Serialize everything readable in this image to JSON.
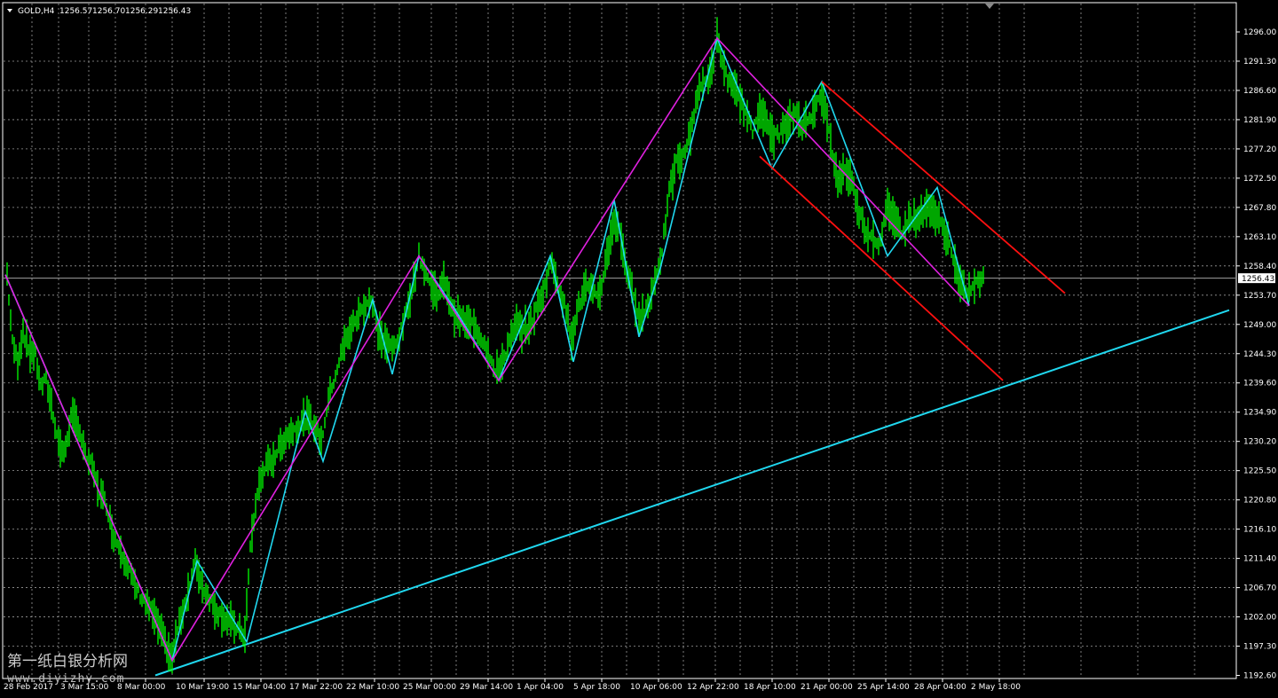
{
  "header": {
    "symbol": "GOLD,H4",
    "open": "1256.57",
    "high": "1256.70",
    "low": "1256.29",
    "close": "1256.43"
  },
  "watermark": {
    "line1": "第一纸白银分析网",
    "line2": "www.diyizhy.com"
  },
  "colors": {
    "background": "#000000",
    "grid": "#9a9a9a",
    "axis": "#ffffff",
    "price": "#00ff00",
    "zigzag_major": "#e020e0",
    "zigzag_minor": "#20d8f0",
    "channel": "#ff1010",
    "trendline": "#20d8f0",
    "current_price_line": "#a0a0a0"
  },
  "chart_data": {
    "type": "line",
    "grid": true,
    "ylim": [
      1192.6,
      1298.2
    ],
    "xlim": [
      0,
      1400
    ],
    "y_ticks": [
      "1296.00",
      "1291.30",
      "1286.60",
      "1281.90",
      "1277.20",
      "1272.50",
      "1267.80",
      "1263.10",
      "1258.40",
      "1253.70",
      "1249.00",
      "1244.30",
      "1239.60",
      "1234.90",
      "1230.20",
      "1225.50",
      "1220.80",
      "1216.10",
      "1211.40",
      "1206.70",
      "1202.00",
      "1197.30",
      "1192.60"
    ],
    "x_ticks": [
      {
        "label": "28 Feb 2017",
        "x": 2
      },
      {
        "label": "3 Mar 15:00",
        "x": 66
      },
      {
        "label": "8 Mar 00:00",
        "x": 130
      },
      {
        "label": "10 Mar 19:00",
        "x": 196
      },
      {
        "label": "15 Mar 04:00",
        "x": 260
      },
      {
        "label": "17 Mar 22:00",
        "x": 324
      },
      {
        "label": "22 Mar 10:00",
        "x": 388
      },
      {
        "label": "25 Mar 00:00",
        "x": 452
      },
      {
        "label": "29 Mar 14:00",
        "x": 516
      },
      {
        "label": "1 Apr 04:00",
        "x": 580
      },
      {
        "label": "5 Apr 18:00",
        "x": 644
      },
      {
        "label": "10 Apr 06:00",
        "x": 708
      },
      {
        "label": "12 Apr 22:00",
        "x": 772
      },
      {
        "label": "18 Apr 10:00",
        "x": 836
      },
      {
        "label": "21 Apr 00:00",
        "x": 900
      },
      {
        "label": "25 Apr 14:00",
        "x": 964
      },
      {
        "label": "28 Apr 04:00",
        "x": 1028
      },
      {
        "label": "2 May 18:00",
        "x": 1092
      }
    ],
    "current_price": 1256.43,
    "price_anchors": [
      [
        8,
        1257
      ],
      [
        14,
        1246
      ],
      [
        20,
        1243
      ],
      [
        26,
        1248
      ],
      [
        32,
        1245
      ],
      [
        40,
        1244
      ],
      [
        46,
        1239
      ],
      [
        52,
        1240
      ],
      [
        58,
        1236
      ],
      [
        66,
        1230
      ],
      [
        72,
        1228
      ],
      [
        80,
        1234
      ],
      [
        88,
        1233
      ],
      [
        96,
        1228
      ],
      [
        104,
        1226
      ],
      [
        112,
        1222
      ],
      [
        120,
        1220
      ],
      [
        128,
        1215
      ],
      [
        136,
        1213
      ],
      [
        144,
        1210
      ],
      [
        152,
        1207
      ],
      [
        160,
        1205
      ],
      [
        170,
        1203
      ],
      [
        180,
        1200
      ],
      [
        188,
        1197
      ],
      [
        194,
        1195
      ],
      [
        200,
        1200
      ],
      [
        206,
        1203
      ],
      [
        212,
        1206
      ],
      [
        220,
        1211
      ],
      [
        228,
        1207
      ],
      [
        236,
        1205
      ],
      [
        244,
        1203
      ],
      [
        252,
        1202
      ],
      [
        260,
        1201
      ],
      [
        268,
        1200
      ],
      [
        276,
        1199
      ],
      [
        282,
        1213
      ],
      [
        290,
        1222
      ],
      [
        298,
        1226
      ],
      [
        306,
        1227
      ],
      [
        314,
        1229
      ],
      [
        322,
        1231
      ],
      [
        330,
        1232
      ],
      [
        338,
        1233
      ],
      [
        346,
        1234
      ],
      [
        354,
        1233
      ],
      [
        362,
        1230
      ],
      [
        370,
        1237
      ],
      [
        378,
        1241
      ],
      [
        386,
        1245
      ],
      [
        394,
        1248
      ],
      [
        402,
        1250
      ],
      [
        410,
        1252
      ],
      [
        418,
        1253
      ],
      [
        426,
        1248
      ],
      [
        434,
        1246
      ],
      [
        442,
        1245
      ],
      [
        450,
        1247
      ],
      [
        458,
        1251
      ],
      [
        466,
        1256
      ],
      [
        472,
        1260
      ],
      [
        478,
        1258
      ],
      [
        486,
        1255
      ],
      [
        494,
        1254
      ],
      [
        502,
        1256
      ],
      [
        510,
        1251
      ],
      [
        518,
        1250
      ],
      [
        526,
        1249
      ],
      [
        534,
        1249
      ],
      [
        542,
        1247
      ],
      [
        550,
        1245
      ],
      [
        558,
        1241
      ],
      [
        566,
        1243
      ],
      [
        574,
        1246
      ],
      [
        582,
        1249
      ],
      [
        590,
        1248
      ],
      [
        598,
        1249
      ],
      [
        606,
        1252
      ],
      [
        614,
        1255
      ],
      [
        620,
        1259
      ],
      [
        628,
        1256
      ],
      [
        636,
        1252
      ],
      [
        644,
        1247
      ],
      [
        652,
        1252
      ],
      [
        660,
        1255
      ],
      [
        668,
        1254
      ],
      [
        676,
        1254
      ],
      [
        684,
        1260
      ],
      [
        692,
        1266
      ],
      [
        698,
        1264
      ],
      [
        706,
        1258
      ],
      [
        714,
        1253
      ],
      [
        722,
        1250
      ],
      [
        730,
        1252
      ],
      [
        738,
        1256
      ],
      [
        746,
        1261
      ],
      [
        754,
        1270
      ],
      [
        762,
        1275
      ],
      [
        770,
        1276
      ],
      [
        778,
        1280
      ],
      [
        786,
        1286
      ],
      [
        794,
        1288
      ],
      [
        802,
        1290
      ],
      [
        808,
        1295
      ],
      [
        816,
        1290
      ],
      [
        824,
        1287
      ],
      [
        832,
        1286
      ],
      [
        840,
        1283
      ],
      [
        848,
        1280
      ],
      [
        856,
        1284
      ],
      [
        864,
        1281
      ],
      [
        872,
        1279
      ],
      [
        880,
        1280
      ],
      [
        888,
        1281
      ],
      [
        896,
        1283
      ],
      [
        904,
        1281
      ],
      [
        912,
        1282
      ],
      [
        920,
        1285
      ],
      [
        928,
        1285
      ],
      [
        936,
        1278
      ],
      [
        944,
        1272
      ],
      [
        952,
        1274
      ],
      [
        960,
        1272
      ],
      [
        968,
        1267
      ],
      [
        976,
        1264
      ],
      [
        984,
        1263
      ],
      [
        992,
        1262
      ],
      [
        1000,
        1268
      ],
      [
        1008,
        1266
      ],
      [
        1016,
        1264
      ],
      [
        1024,
        1266
      ],
      [
        1032,
        1266
      ],
      [
        1040,
        1267
      ],
      [
        1048,
        1268
      ],
      [
        1056,
        1266
      ],
      [
        1064,
        1264
      ],
      [
        1072,
        1261
      ],
      [
        1080,
        1256
      ],
      [
        1088,
        1254
      ],
      [
        1096,
        1255
      ],
      [
        1104,
        1256
      ],
      [
        1110,
        1256.4
      ]
    ],
    "zigzag_major": [
      [
        6,
        1257
      ],
      [
        194,
        1195
      ],
      [
        472,
        1260
      ],
      [
        562,
        1240
      ],
      [
        808,
        1295
      ],
      [
        1092,
        1252
      ]
    ],
    "zigzag_minor": [
      [
        6,
        1257
      ],
      [
        194,
        1195
      ],
      [
        222,
        1211
      ],
      [
        278,
        1198
      ],
      [
        344,
        1235
      ],
      [
        364,
        1227
      ],
      [
        420,
        1253
      ],
      [
        442,
        1241
      ],
      [
        472,
        1260
      ],
      [
        510,
        1252
      ],
      [
        562,
        1240
      ],
      [
        620,
        1260
      ],
      [
        646,
        1243
      ],
      [
        692,
        1269
      ],
      [
        720,
        1247
      ],
      [
        744,
        1258
      ],
      [
        808,
        1295
      ],
      [
        870,
        1274
      ],
      [
        926,
        1288
      ],
      [
        1000,
        1260
      ],
      [
        1056,
        1271
      ],
      [
        1092,
        1252
      ]
    ],
    "channel_upper": [
      [
        926,
        1288
      ],
      [
        1200,
        1254
      ]
    ],
    "channel_lower": [
      [
        856,
        1276
      ],
      [
        1130,
        1240
      ]
    ],
    "trendline": [
      [
        175,
        1192.6
      ],
      [
        1385,
        1251.3
      ]
    ]
  }
}
